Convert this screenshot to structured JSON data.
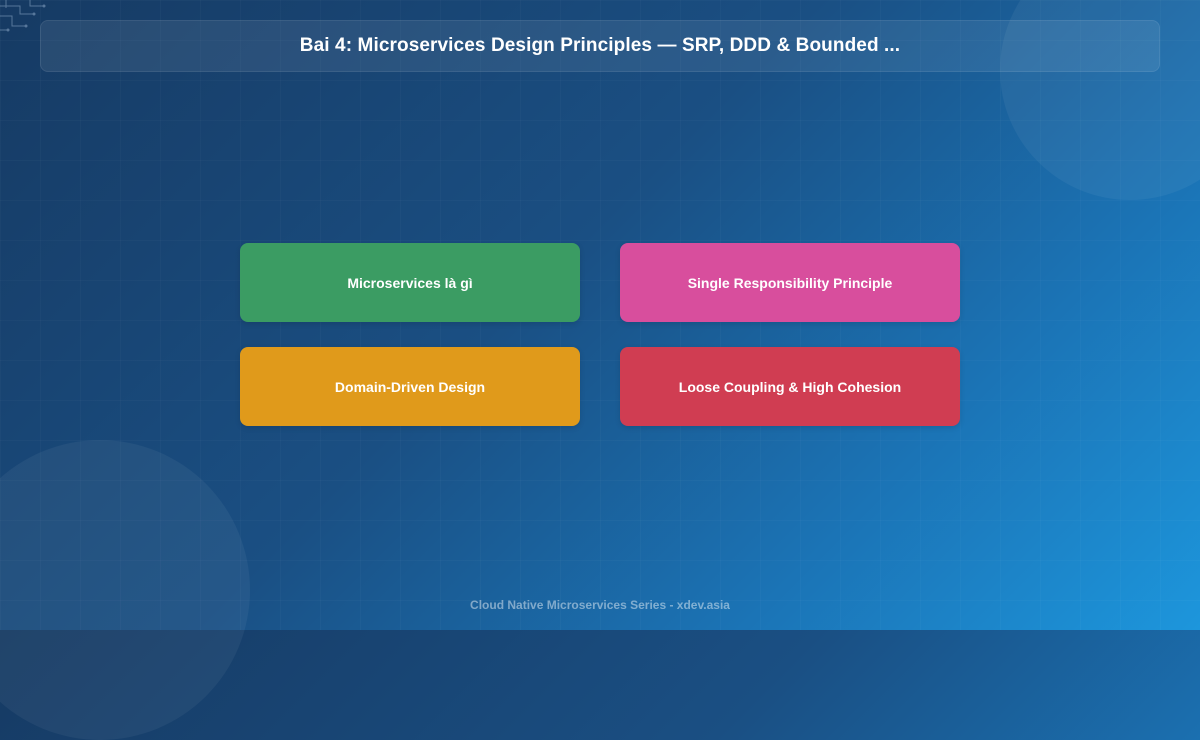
{
  "header": {
    "title": "Bai 4: Microservices Design Principles — SRP, DDD & Bounded ..."
  },
  "topics": [
    {
      "label": "Microservices là gì",
      "color": "#3b9c63"
    },
    {
      "label": "Single Responsibility Principle",
      "color": "#d84e9d"
    },
    {
      "label": "Domain-Driven Design",
      "color": "#e09a1b"
    },
    {
      "label": "Loose Coupling & High Cohesion",
      "color": "#d03d52"
    }
  ],
  "footer": {
    "text": "Cloud Native Microservices Series - xdev.asia"
  },
  "theme": {
    "background_start": "#163a63",
    "background_end": "#1d96dc"
  }
}
